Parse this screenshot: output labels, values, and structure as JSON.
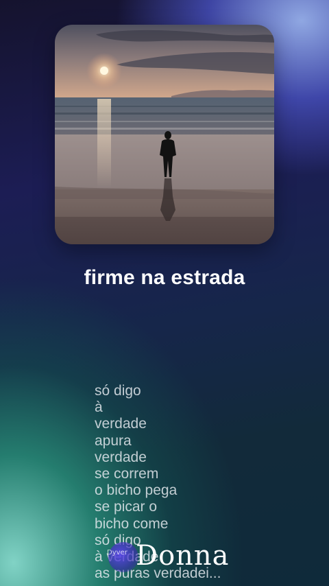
{
  "track": {
    "title": "firme na estrada"
  },
  "lyrics": [
    "só digo",
    "à",
    "verdade",
    "apura",
    "verdade",
    "se correm",
    "o bicho pega",
    "se picar o",
    "bicho come",
    "só digo",
    "à verdade",
    "as puras verdadei..."
  ],
  "watermark": {
    "small": "Dyver",
    "name": "Donna"
  },
  "art": {
    "icon": "album-cover-beach-sunset",
    "colors": {
      "sky_top": "#5a5a6a",
      "sky_horizon": "#c89a80",
      "sun": "#fff4d6",
      "sea": "#4a5868",
      "sand": "#8a7a72",
      "figure": "#111111"
    }
  },
  "colors": {
    "title": "#ffffff",
    "lyrics": "#e8ecf0"
  }
}
